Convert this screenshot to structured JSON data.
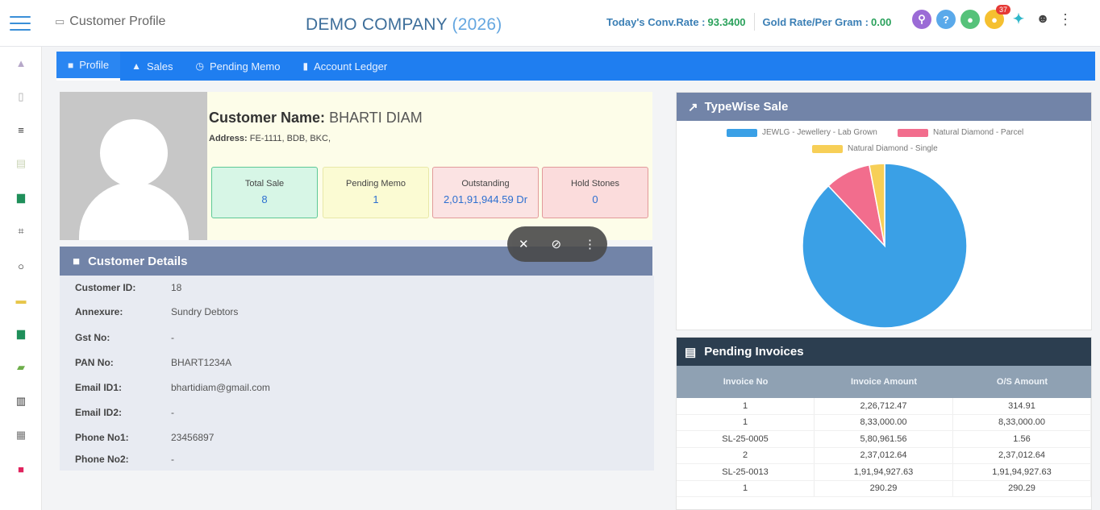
{
  "header": {
    "page_title": "Customer Profile",
    "company_name": "DEMO COMPANY",
    "company_year": "(2026)",
    "conv_rate_label": "Today's Conv.Rate :",
    "conv_rate_value": "93.3400",
    "gold_rate_label": "Gold Rate/Per Gram :",
    "gold_rate_value": "0.00",
    "notification_count": "37",
    "icons": [
      "search-icon",
      "help-icon",
      "chat-icon",
      "notification-icon",
      "sparkle-icon",
      "user-avatar-icon",
      "more-vertical-icon"
    ]
  },
  "sidebar": {
    "icons": [
      "dashboard-icon",
      "document-icon",
      "list-icon",
      "files-icon",
      "store-icon",
      "scan-icon",
      "settings-icon",
      "ticket-icon",
      "shop-icon",
      "truck-icon",
      "chart-icon",
      "barcode-icon",
      "apps-icon"
    ]
  },
  "tabs": [
    {
      "label": "Profile",
      "icon": "user-icon",
      "active": true
    },
    {
      "label": "Sales",
      "icon": "cart-icon",
      "active": false
    },
    {
      "label": "Pending Memo",
      "icon": "clock-icon",
      "active": false
    },
    {
      "label": "Account Ledger",
      "icon": "book-icon",
      "active": false
    }
  ],
  "profile": {
    "name_label": "Customer Name:",
    "name_value": "BHARTI DIAM",
    "address_label": "Address:",
    "address_value": "FE-1111, BDB, BKC,",
    "stats": [
      {
        "label": "Total Sale",
        "value": "8",
        "bg": "#d7f6e6",
        "border": "#5cc996"
      },
      {
        "label": "Pending Memo",
        "value": "1",
        "bg": "#fbfbd3",
        "border": "#e8e8a8"
      },
      {
        "label": "Outstanding",
        "value": "2,01,91,944.59 Dr",
        "bg": "#fbe3e3",
        "border": "#e29a9a"
      },
      {
        "label": "Hold Stones",
        "value": "0",
        "bg": "#fbdcdc",
        "border": "#e29a9a"
      }
    ]
  },
  "details": {
    "title": "Customer Details",
    "rows": [
      {
        "key": "Customer ID:",
        "value": "18"
      },
      {
        "key": "Annexure:",
        "value": "Sundry Debtors"
      },
      {
        "key": "Gst No:",
        "value": "-"
      },
      {
        "key": "PAN No:",
        "value": "BHART1234A"
      },
      {
        "key": "Email ID1:",
        "value": "bhartidiam@gmail.com"
      },
      {
        "key": "Email ID2:",
        "value": "-"
      },
      {
        "key": "Phone No1:",
        "value": "23456897"
      },
      {
        "key": "Phone No2:",
        "value": "-"
      }
    ]
  },
  "typewise": {
    "title": "TypeWise Sale",
    "chart_data": {
      "type": "pie",
      "series": [
        {
          "name": "JEWLG - Jewellery - Lab Grown",
          "color": "#3aa0e6",
          "share": 0.88
        },
        {
          "name": "Natural Diamond - Parcel",
          "color": "#f26d8d",
          "share": 0.09
        },
        {
          "name": "Natural Diamond - Single",
          "color": "#f7cf57",
          "share": 0.03
        }
      ]
    }
  },
  "pending_invoices": {
    "title": "Pending Invoices",
    "columns": [
      "Invoice No",
      "Invoice Amount",
      "O/S Amount"
    ],
    "rows": [
      [
        "1",
        "2,26,712.47",
        "314.91"
      ],
      [
        "1",
        "8,33,000.00",
        "8,33,000.00"
      ],
      [
        "SL-25-0005",
        "5,80,961.56",
        "1.56"
      ],
      [
        "2",
        "2,37,012.64",
        "2,37,012.64"
      ],
      [
        "SL-25-0013",
        "1,91,94,927.63",
        "1,91,94,927.63"
      ],
      [
        "1",
        "290.29",
        "290.29"
      ]
    ]
  }
}
